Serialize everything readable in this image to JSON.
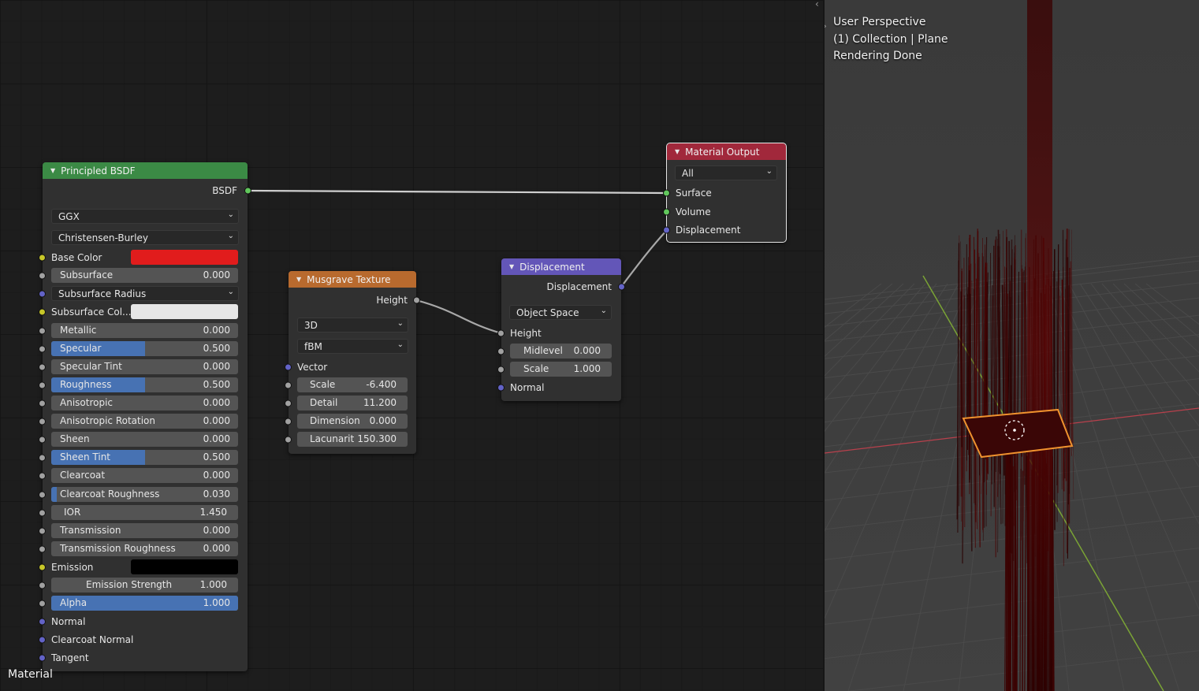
{
  "node_editor": {
    "context_label": "Material",
    "nodes": {
      "principled": {
        "title": "Principled BSDF",
        "header_color": "#3b8a45",
        "output_label": "BSDF",
        "distribution": "GGX",
        "subsurface_method": "Christensen-Burley",
        "base_color_label": "Base Color",
        "base_color": "#e11c1c",
        "subsurface_label": "Subsurface",
        "subsurface_value": "0.000",
        "subsurface_radius_label": "Subsurface Radius",
        "subsurface_color_label": "Subsurface Col...",
        "subsurface_color": "#e6e6e6",
        "metallic_label": "Metallic",
        "metallic_value": "0.000",
        "specular_label": "Specular",
        "specular_value": "0.500",
        "specular_fill": 0.5,
        "specular_tint_label": "Specular Tint",
        "specular_tint_value": "0.000",
        "roughness_label": "Roughness",
        "roughness_value": "0.500",
        "roughness_fill": 0.5,
        "anisotropic_label": "Anisotropic",
        "anisotropic_value": "0.000",
        "anisotropic_rotation_label": "Anisotropic Rotation",
        "anisotropic_rotation_value": "0.000",
        "sheen_label": "Sheen",
        "sheen_value": "0.000",
        "sheen_tint_label": "Sheen Tint",
        "sheen_tint_value": "0.500",
        "sheen_tint_fill": 0.5,
        "clearcoat_label": "Clearcoat",
        "clearcoat_value": "0.000",
        "clearcoat_roughness_label": "Clearcoat Roughness",
        "clearcoat_roughness_value": "0.030",
        "clearcoat_roughness_fill": 0.03,
        "ior_label": "IOR",
        "ior_value": "1.450",
        "transmission_label": "Transmission",
        "transmission_value": "0.000",
        "transmission_roughness_label": "Transmission Roughness",
        "transmission_roughness_value": "0.000",
        "emission_label": "Emission",
        "emission_color": "#000000",
        "emission_strength_label": "Emission Strength",
        "emission_strength_value": "1.000",
        "alpha_label": "Alpha",
        "alpha_value": "1.000",
        "alpha_fill": 1.0,
        "normal_label": "Normal",
        "clearcoat_normal_label": "Clearcoat Normal",
        "tangent_label": "Tangent"
      },
      "musgrave": {
        "title": "Musgrave Texture",
        "header_color": "#b86a2e",
        "output_label": "Height",
        "dimensions": "3D",
        "type": "fBM",
        "vector_label": "Vector",
        "scale_label": "Scale",
        "scale_value": "-6.400",
        "detail_label": "Detail",
        "detail_value": "11.200",
        "dimension_label": "Dimension",
        "dimension_value": "0.000",
        "lacunarity_label": "Lacunarit",
        "lacunarity_value": "150.300"
      },
      "displacement": {
        "title": "Displacement",
        "header_color": "#6356b8",
        "output_label": "Displacement",
        "space": "Object Space",
        "height_label": "Height",
        "midlevel_label": "Midlevel",
        "midlevel_value": "0.000",
        "scale_label": "Scale",
        "scale_value": "1.000",
        "normal_label": "Normal"
      },
      "output": {
        "title": "Material Output",
        "header_color": "#a1283b",
        "target": "All",
        "surface_label": "Surface",
        "volume_label": "Volume",
        "displacement_label": "Displacement"
      }
    }
  },
  "viewport": {
    "line1": "User Perspective",
    "line2": "(1) Collection | Plane",
    "line3": "Rendering Done",
    "selection_color": "#f0922e",
    "x_axis_color": "#b8404c",
    "y_axis_color": "#7aa335"
  }
}
